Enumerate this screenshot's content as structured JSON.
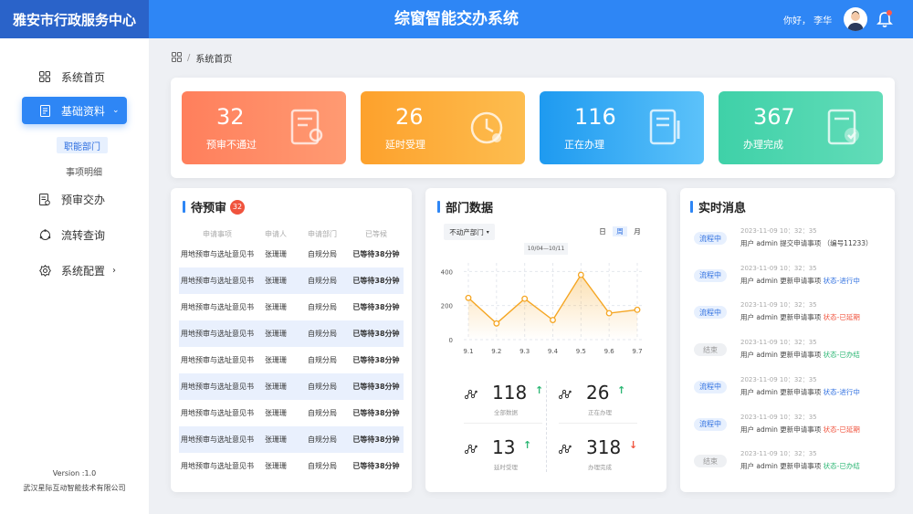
{
  "header": {
    "org": "雅安市行政服务中心",
    "system": "综窗智能交办系统",
    "greeting": "你好， 李华"
  },
  "sidebar": {
    "nav": [
      {
        "label": "系统首页",
        "icon": "grid-icon"
      },
      {
        "label": "基础资料",
        "icon": "document-icon",
        "expanded": true
      },
      {
        "label": "预审交办",
        "icon": "review-icon"
      },
      {
        "label": "流转查询",
        "icon": "flow-icon"
      },
      {
        "label": "系统配置",
        "icon": "settings-icon"
      }
    ],
    "sub": [
      "职能部门",
      "事项明细"
    ],
    "version": "Version :1.0",
    "company": "武汉星际互动智能技术有限公司"
  },
  "breadcrumb": {
    "sep": "/",
    "current": "系统首页"
  },
  "stats": [
    {
      "value": "32",
      "label": "预审不通过",
      "color": "#ff7f5c"
    },
    {
      "value": "26",
      "label": "延时受理",
      "color": "#fda12c"
    },
    {
      "value": "116",
      "label": "正在办理",
      "color": "#23a2f2"
    },
    {
      "value": "367",
      "label": "办理完成",
      "color": "#3fd1a8"
    }
  ],
  "pending": {
    "title": "待预审",
    "count": "32",
    "headers": [
      "申请事项",
      "申请人",
      "申请部门",
      "已等候"
    ],
    "rows": [
      [
        "用地预审与选址意见书",
        "张珊珊",
        "自规分局",
        "已等待38分钟"
      ],
      [
        "用地预审与选址意见书",
        "张珊珊",
        "自规分局",
        "已等待38分钟"
      ],
      [
        "用地预审与选址意见书",
        "张珊珊",
        "自规分局",
        "已等待38分钟"
      ],
      [
        "用地预审与选址意见书",
        "张珊珊",
        "自规分局",
        "已等待38分钟"
      ],
      [
        "用地预审与选址意见书",
        "张珊珊",
        "自规分局",
        "已等待38分钟"
      ],
      [
        "用地预审与选址意见书",
        "张珊珊",
        "自规分局",
        "已等待38分钟"
      ],
      [
        "用地预审与选址意见书",
        "张珊珊",
        "自规分局",
        "已等待38分钟"
      ],
      [
        "用地预审与选址意见书",
        "张珊珊",
        "自规分局",
        "已等待38分钟"
      ],
      [
        "用地预审与选址意见书",
        "张珊珊",
        "自规分局",
        "已等待38分钟"
      ]
    ]
  },
  "dept": {
    "title": "部门数据",
    "select": "不动产部门",
    "tabs": [
      "日",
      "周",
      "月"
    ],
    "range": "10/04—10/11",
    "kpis": [
      {
        "value": "118",
        "label": "全部数据",
        "trend": "up"
      },
      {
        "value": "26",
        "label": "正在办理",
        "trend": "up"
      },
      {
        "value": "13",
        "label": "延时受理",
        "trend": "up"
      },
      {
        "value": "318",
        "label": "办理完成",
        "trend": "down"
      }
    ]
  },
  "chart_data": {
    "type": "area",
    "categories": [
      "9.1",
      "9.2",
      "9.3",
      "9.4",
      "9.5",
      "9.6",
      "9.7"
    ],
    "values": [
      245,
      95,
      240,
      115,
      380,
      155,
      175
    ],
    "ylim": [
      0,
      450
    ],
    "yticks": [
      0,
      200,
      400
    ],
    "grid": true,
    "color": "#f5a623"
  },
  "messages": {
    "title": "实时消息",
    "items": [
      {
        "tag": "流程中",
        "kind": "blue",
        "time": "2023-11-09  10：32：35",
        "text": "用户 admin 提交申请事项",
        "status": "（编号11233）",
        "statusColor": "#444"
      },
      {
        "tag": "流程中",
        "kind": "blue",
        "time": "2023-11-09  10：32：35",
        "text": "用户 admin 更新申请事项",
        "status": "状态-进行中",
        "statusColor": "#2e6fe0"
      },
      {
        "tag": "流程中",
        "kind": "blue",
        "time": "2023-11-09  10：32：35",
        "text": "用户 admin 更新申请事项",
        "status": "状态-已延期",
        "statusColor": "#f0533d"
      },
      {
        "tag": "结束",
        "kind": "gray",
        "time": "2023-11-09  10：32：35",
        "text": "用户 admin 更新申请事项",
        "status": "状态-已办结",
        "statusColor": "#2bb673"
      },
      {
        "tag": "流程中",
        "kind": "blue",
        "time": "2023-11-09  10：32：35",
        "text": "用户 admin 更新申请事项",
        "status": "状态-进行中",
        "statusColor": "#2e6fe0"
      },
      {
        "tag": "流程中",
        "kind": "blue",
        "time": "2023-11-09  10：32：35",
        "text": "用户 admin 更新申请事项",
        "status": "状态-已延期",
        "statusColor": "#f0533d"
      },
      {
        "tag": "结束",
        "kind": "gray",
        "time": "2023-11-09  10：32：35",
        "text": "用户 admin 更新申请事项",
        "status": "状态-已办结",
        "statusColor": "#2bb673"
      }
    ]
  }
}
